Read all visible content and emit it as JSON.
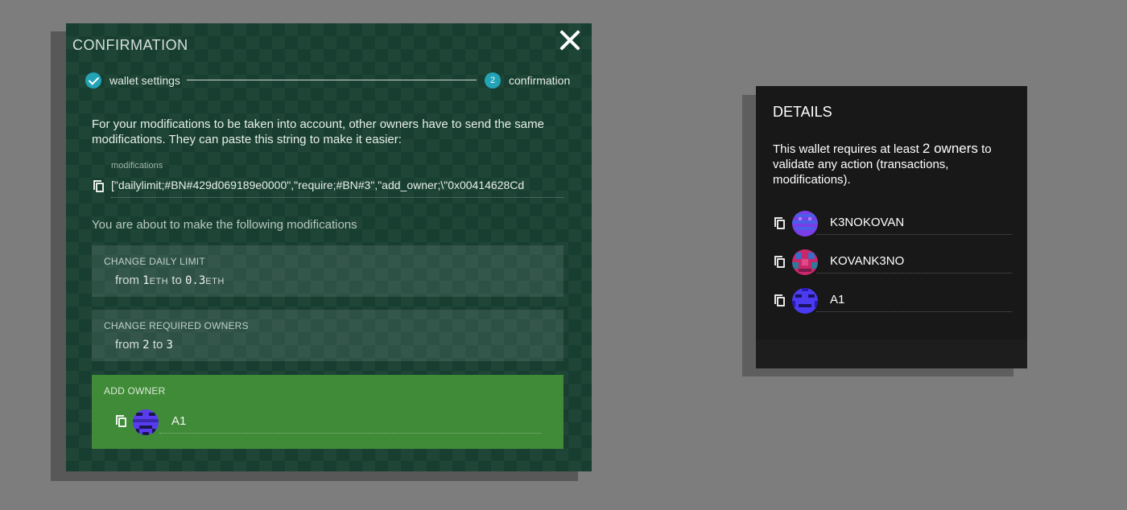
{
  "modal": {
    "title": "CONFIRMATION",
    "steps": [
      {
        "label": "wallet settings",
        "status": "done"
      },
      {
        "number": "2",
        "label": "confirmation",
        "status": "active"
      }
    ],
    "intro": "For your modifications to be taken into account, other owners have to send the same modifications. They can paste this string to make it easier:",
    "modifications_label": "modifications",
    "modifications_value": "[\"dailylimit;#BN#429d069189e0000\",\"require;#BN#3\",\"add_owner;\\\"0x00414628Cd",
    "about_text": "You are about to make the following modifications",
    "cards": {
      "daily": {
        "title": "CHANGE DAILY LIMIT",
        "from_word": "from",
        "from_value": "1",
        "from_unit": "ETH",
        "to_word": "to",
        "to_value": "0.3",
        "to_unit": "ETH"
      },
      "required": {
        "title": "CHANGE REQUIRED OWNERS",
        "from_word": "from",
        "from_value": "2",
        "to_word": "to",
        "to_value": "3"
      },
      "add_owner": {
        "title": "ADD OWNER",
        "owner_name": "A1"
      }
    }
  },
  "details": {
    "title": "DETAILS",
    "text_prefix": "This wallet requires at least",
    "required_count": "2 owners",
    "text_suffix": "to validate any action (transactions, modifications).",
    "owners": [
      {
        "name": "K3NOKOVAN",
        "avatar": "purple-pixel-avatar"
      },
      {
        "name": "KOVANK3NO",
        "avatar": "red-pixel-avatar"
      },
      {
        "name": "A1",
        "avatar": "blue-pixel-avatar"
      }
    ]
  },
  "colors": {
    "modal_bg": "#173e30",
    "step_accent": "#22a3b6",
    "add_owner_bg": "#3f8b38",
    "details_bg": "#181818",
    "page_bg": "#7d7d7d"
  }
}
